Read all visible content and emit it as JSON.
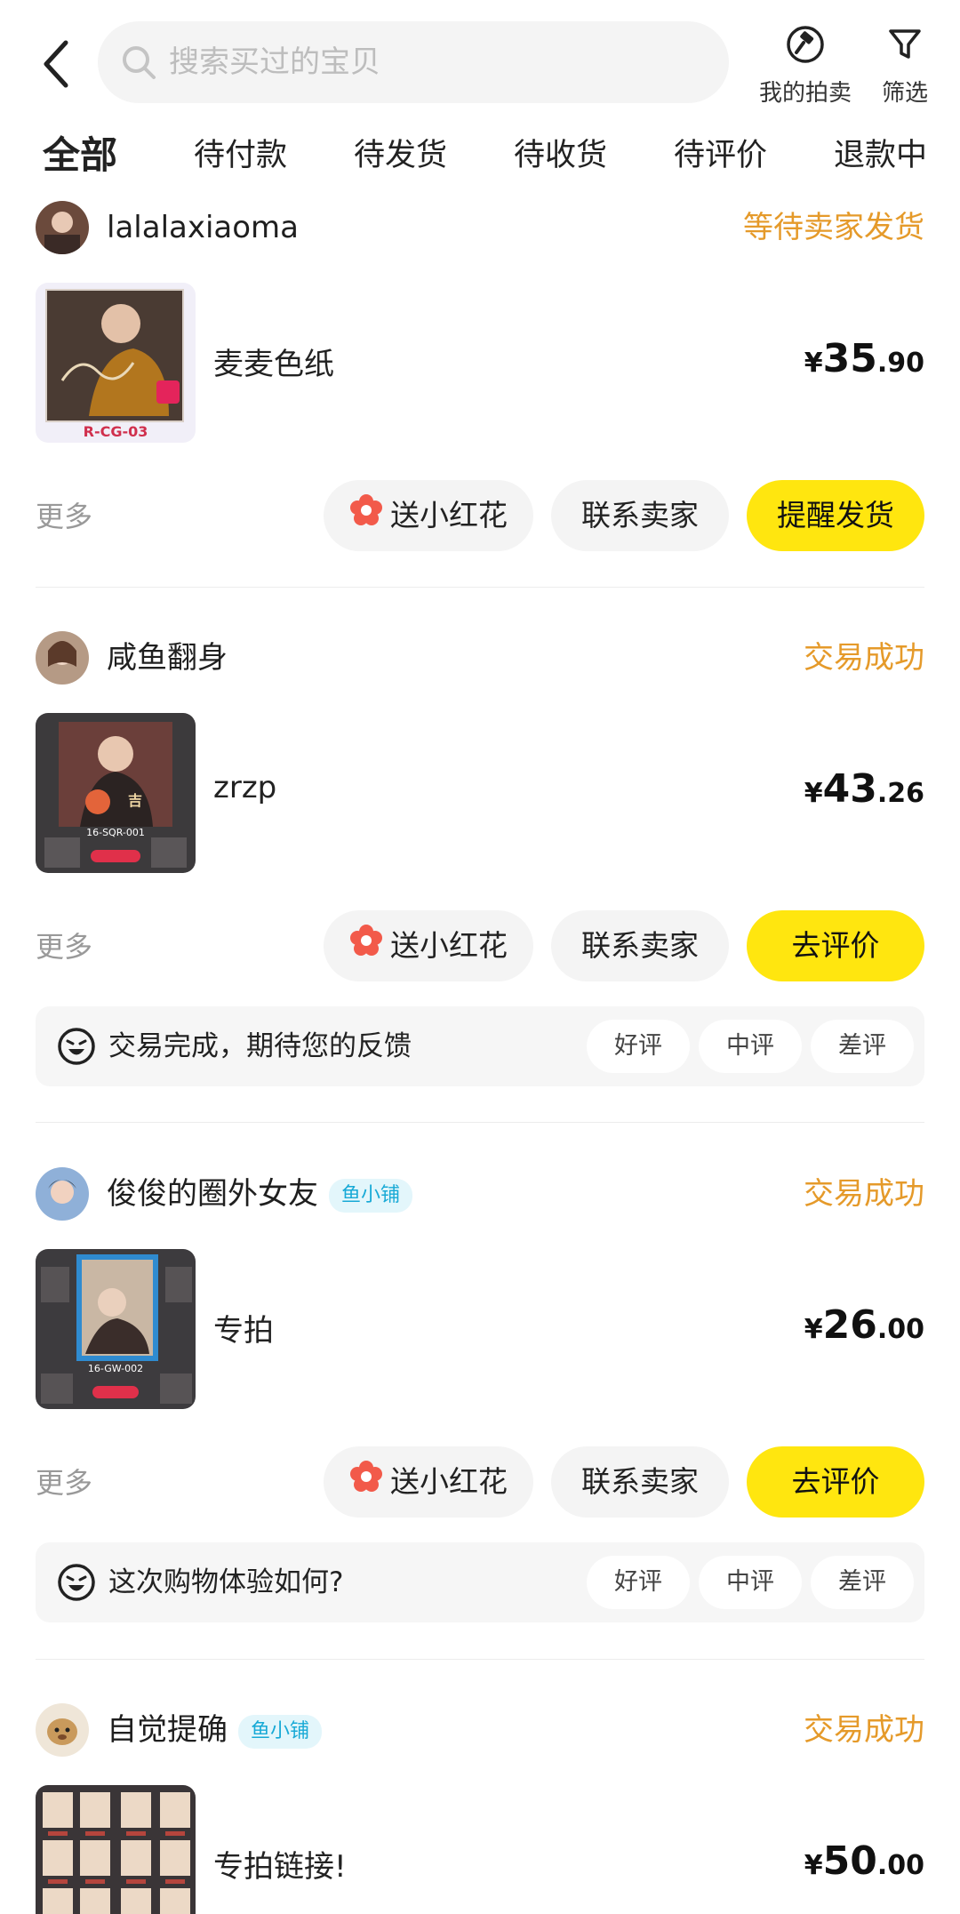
{
  "header": {
    "search_placeholder": "搜索买过的宝贝",
    "auction_label": "我的拍卖",
    "filter_label": "筛选"
  },
  "tabs": [
    {
      "label": "全部"
    },
    {
      "label": "待付款"
    },
    {
      "label": "待发货"
    },
    {
      "label": "待收货"
    },
    {
      "label": "待评价"
    },
    {
      "label": "退款中"
    }
  ],
  "orders": [
    {
      "shop": "lalalaxiaoma",
      "status": "等待卖家发货",
      "title": "麦麦色纸",
      "price_int": "35",
      "price_dec": ".90",
      "currency": "¥",
      "thumb_caption": "R-CG-03",
      "more": "更多",
      "btn_flower": "送小红花",
      "btn_contact": "联系卖家",
      "btn_primary": "提醒发货"
    },
    {
      "shop": "咸鱼翻身",
      "status": "交易成功",
      "title": "zrzp",
      "price_int": "43",
      "price_dec": ".26",
      "currency": "¥",
      "thumb_caption": "16-SQR-001",
      "more": "更多",
      "btn_flower": "送小红花",
      "btn_contact": "联系卖家",
      "btn_primary": "去评价",
      "feedback": "交易完成，期待您的反馈",
      "rate_good": "好评",
      "rate_mid": "中评",
      "rate_bad": "差评"
    },
    {
      "shop": "俊俊的圈外女友",
      "badge": "鱼小铺",
      "status": "交易成功",
      "title": "专拍",
      "price_int": "26",
      "price_dec": ".00",
      "currency": "¥",
      "thumb_caption": "16-GW-002",
      "more": "更多",
      "btn_flower": "送小红花",
      "btn_contact": "联系卖家",
      "btn_primary": "去评价",
      "feedback": "这次购物体验如何?",
      "rate_good": "好评",
      "rate_mid": "中评",
      "rate_bad": "差评"
    },
    {
      "shop": "自觉提确",
      "badge": "鱼小铺",
      "status": "交易成功",
      "title": "专拍链接!",
      "price_int": "50",
      "price_dec": ".00",
      "currency": "¥"
    }
  ],
  "colors": {
    "accent_yellow": "#ffe60f",
    "status_orange": "#e59a2a",
    "badge_blue": "#17a9d6"
  },
  "icons": [
    "back-arrow-icon",
    "search-icon",
    "auction-gavel-icon",
    "filter-funnel-icon",
    "flower-icon",
    "face-icon"
  ]
}
